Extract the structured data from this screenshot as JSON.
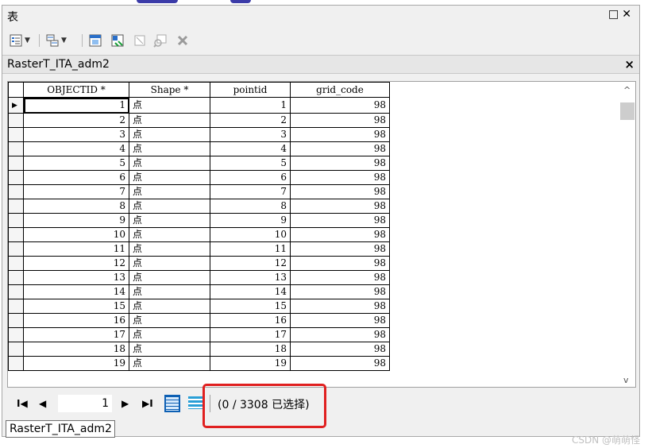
{
  "window": {
    "title": "表",
    "controls": [
      "□",
      "✕"
    ]
  },
  "tab": {
    "title": "RasterT_ITA_adm2",
    "close": "×"
  },
  "table": {
    "columns": [
      "OBJECTID *",
      "Shape *",
      "pointid",
      "grid_code"
    ],
    "rows": [
      [
        "1",
        "点",
        "1",
        "98"
      ],
      [
        "2",
        "点",
        "2",
        "98"
      ],
      [
        "3",
        "点",
        "3",
        "98"
      ],
      [
        "4",
        "点",
        "4",
        "98"
      ],
      [
        "5",
        "点",
        "5",
        "98"
      ],
      [
        "6",
        "点",
        "6",
        "98"
      ],
      [
        "7",
        "点",
        "7",
        "98"
      ],
      [
        "8",
        "点",
        "8",
        "98"
      ],
      [
        "9",
        "点",
        "9",
        "98"
      ],
      [
        "10",
        "点",
        "10",
        "98"
      ],
      [
        "11",
        "点",
        "11",
        "98"
      ],
      [
        "12",
        "点",
        "12",
        "98"
      ],
      [
        "13",
        "点",
        "13",
        "98"
      ],
      [
        "14",
        "点",
        "14",
        "98"
      ],
      [
        "15",
        "点",
        "15",
        "98"
      ],
      [
        "16",
        "点",
        "16",
        "98"
      ],
      [
        "17",
        "点",
        "17",
        "98"
      ],
      [
        "18",
        "点",
        "18",
        "98"
      ],
      [
        "19",
        "点",
        "19",
        "98"
      ]
    ]
  },
  "nav": {
    "first": "I◀",
    "prev": "◀",
    "record": "1",
    "next": "▶",
    "last": "▶I"
  },
  "selection": {
    "text": "(0 / 3308 已选择)"
  },
  "bottom_tab": {
    "label": "RasterT_ITA_adm2"
  },
  "watermark": "CSDN @萌萌怪",
  "colors": {
    "highlight": "#e02020",
    "view_active": "#0d5fb3"
  }
}
